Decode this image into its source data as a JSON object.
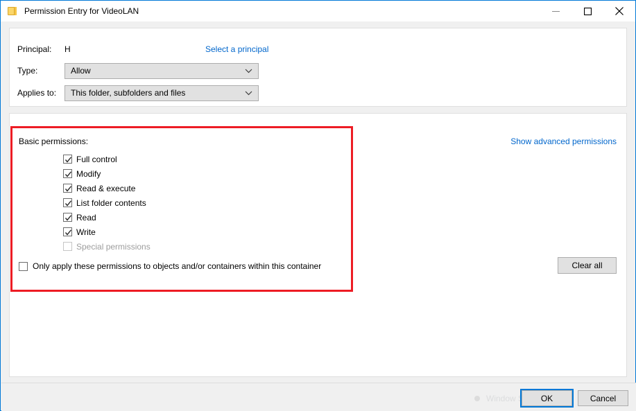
{
  "window": {
    "title": "Permission Entry for VideoLAN",
    "icon": "folder-icon",
    "controls": {
      "minimize": "Minimize",
      "maximize": "Maximize",
      "close": "Close"
    }
  },
  "form": {
    "principal_label": "Principal:",
    "principal_value": "H",
    "select_principal_link": "Select a principal",
    "type_label": "Type:",
    "type_value": "Allow",
    "applies_to_label": "Applies to:",
    "applies_to_value": "This folder, subfolders and files"
  },
  "permissions": {
    "section_label": "Basic permissions:",
    "advanced_link": "Show advanced permissions",
    "items": [
      {
        "label": "Full control",
        "checked": true,
        "disabled": false
      },
      {
        "label": "Modify",
        "checked": true,
        "disabled": false
      },
      {
        "label": "Read & execute",
        "checked": true,
        "disabled": false
      },
      {
        "label": "List folder contents",
        "checked": true,
        "disabled": false
      },
      {
        "label": "Read",
        "checked": true,
        "disabled": false
      },
      {
        "label": "Write",
        "checked": true,
        "disabled": false
      },
      {
        "label": "Special permissions",
        "checked": false,
        "disabled": true
      }
    ],
    "only_apply_label": "Only apply these permissions to objects and/or containers within this container",
    "only_apply_checked": false,
    "clear_all_label": "Clear all"
  },
  "footer": {
    "ok_label": "OK",
    "cancel_label": "Cancel",
    "ghost_overlay_text": "Window Snip"
  },
  "colors": {
    "accent": "#0078d7",
    "link": "#0066cc",
    "annotation": "#ed1c24",
    "control_face": "#e1e1e1",
    "dialog_background": "#f0f0f0"
  }
}
